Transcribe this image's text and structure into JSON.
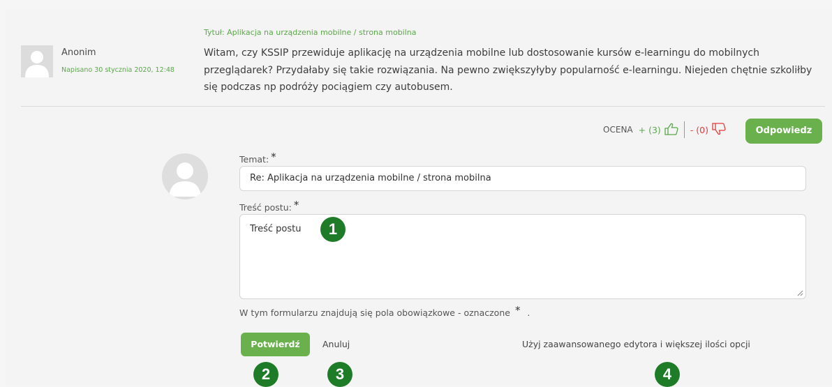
{
  "post": {
    "author": "Anonim",
    "date": "Napisano 30 stycznia 2020, 12:48",
    "title": "Tytuł: Aplikacja na urządzenia mobilne / strona mobilna",
    "body": "Witam, czy KSSIP przewiduje aplikację na urządzenia mobilne lub dostosowanie kursów e-learningu do mobilnych przeglądarek? Przydałaby się takie rozwiązania. Na pewno zwiększyłyby popularność e-learningu. Niejeden chętnie szkoliłby się podczas np podróży pociągiem czy autobusem."
  },
  "rating": {
    "label": "OCENA",
    "plus": "+ (3)",
    "minus": "- (0)",
    "plus_icon": "thumbs-up-icon",
    "minus_icon": "thumbs-down-icon"
  },
  "reply_button": "Odpowiedz",
  "form": {
    "subject_label": "Temat:",
    "subject_value": "Re: Aplikacja na urządzenia mobilne / strona mobilna",
    "body_label": "Treść postu:",
    "body_value": "Treść postu",
    "required_mark": "*",
    "note": "W tym formularzu znajdują się pola obowiązkowe - oznaczone",
    "note_mark": "*",
    "note_end": ".",
    "confirm": "Potwierdź",
    "cancel": "Anuluj",
    "advanced": "Użyj zaawansowanego edytora i większej ilości opcji"
  },
  "badges": [
    "1",
    "2",
    "3",
    "4"
  ],
  "colors": {
    "accent_green": "#6ab04c",
    "badge_green": "#1e7b28",
    "date_green": "#5aa84a",
    "negative_red": "#e23b3b"
  }
}
